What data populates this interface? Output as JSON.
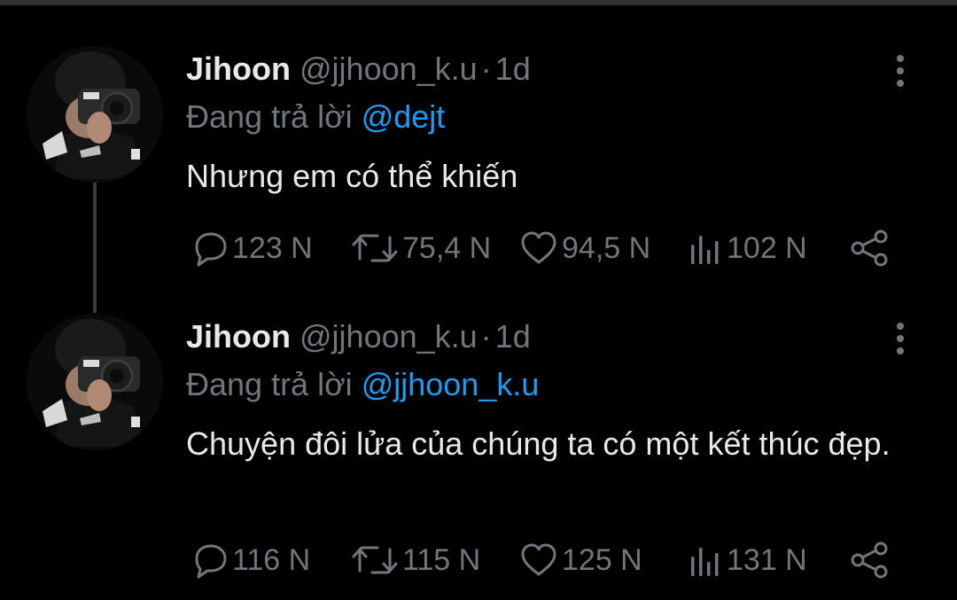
{
  "tweets": [
    {
      "display_name": "Jihoon",
      "handle": "@jjhoon_k.u",
      "separator": "·",
      "time": "1d",
      "reply_prefix": "Đang trả lời",
      "reply_to": "@dejt",
      "text": "Nhưng em có thể khiến",
      "stats": {
        "replies": "123 N",
        "retweets": "75,4 N",
        "likes": "94,5 N",
        "views": "102 N"
      }
    },
    {
      "display_name": "Jihoon",
      "handle": "@jjhoon_k.u",
      "separator": "·",
      "time": "1d",
      "reply_prefix": "Đang trả lời",
      "reply_to": "@jjhoon_k.u",
      "text": "Chuyện đôi lửa của chúng ta có một kết thúc đẹp.",
      "stats": {
        "replies": "116 N",
        "retweets": "115 N",
        "likes": "125 N",
        "views": "131 N"
      }
    }
  ],
  "icons": {
    "reply": "comment-bubble-icon",
    "retweet": "retweet-arrows-icon",
    "like": "heart-icon",
    "views": "bar-chart-icon",
    "share": "share-icon",
    "more": "vertical-dots-icon"
  },
  "colors": {
    "background": "#000000",
    "text_primary": "#e7e9ea",
    "text_secondary": "#71767b",
    "mention": "#1d9bf0"
  }
}
